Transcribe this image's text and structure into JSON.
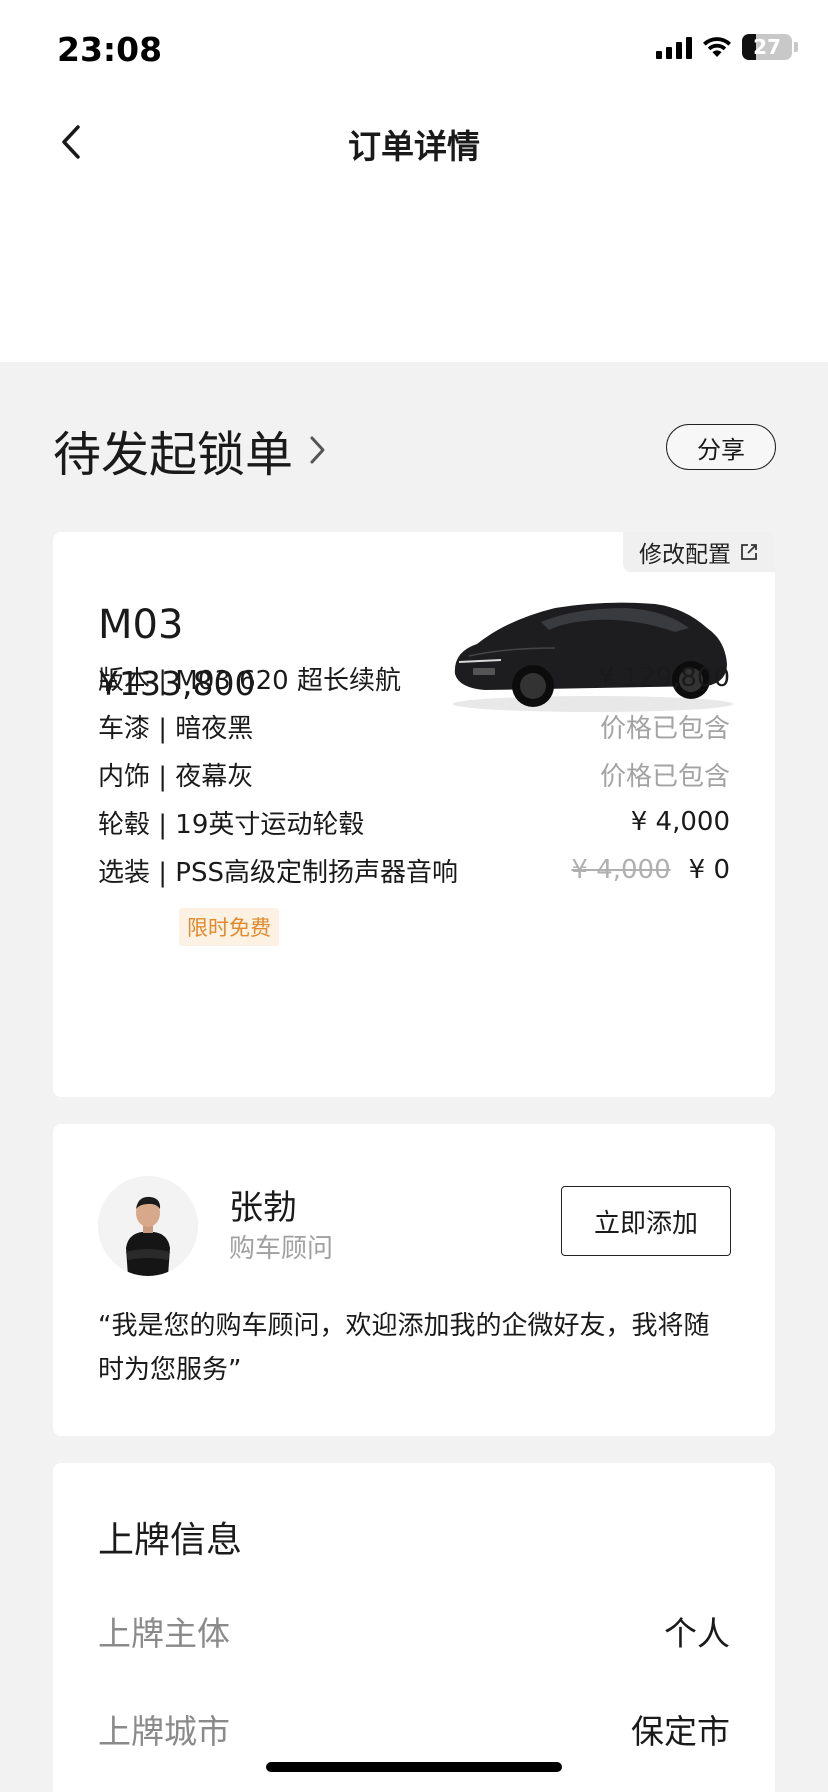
{
  "status_bar": {
    "time": "23:08",
    "battery": "27",
    "battery_level": 0.27
  },
  "nav": {
    "title": "订单详情"
  },
  "order": {
    "status": "待发起锁单",
    "share_label": "分享"
  },
  "config_card": {
    "modify_label": "修改配置",
    "model": "M03",
    "total_price": "¥133,800",
    "specs": [
      {
        "label": "版本 | M03 620 超长续航",
        "value": "¥ 129,800",
        "muted": false
      },
      {
        "label": "车漆 | 暗夜黑",
        "value": "价格已包含",
        "muted": true
      },
      {
        "label": "内饰 | 夜幕灰",
        "value": "价格已包含",
        "muted": true
      },
      {
        "label": "轮毂 | 19英寸运动轮毂",
        "value": "¥ 4,000",
        "muted": false
      },
      {
        "label": "选装 | PSS高级定制扬声器音响",
        "original_value": "¥ 4,000",
        "value": "¥ 0",
        "muted": false
      }
    ],
    "promo_tag": "限时免费"
  },
  "advisor": {
    "name": "张勃",
    "role": "购车顾问",
    "add_label": "立即添加",
    "quote": "“我是您的购车顾问，欢迎添加我的企微好友，我将随时为您服务”"
  },
  "plate_info": {
    "title": "上牌信息",
    "rows": [
      {
        "label": "上牌主体",
        "value": "个人"
      },
      {
        "label": "上牌城市",
        "value": "保定市"
      }
    ]
  },
  "icons": {
    "back": "chevron-left-icon",
    "status_arrow": "chevron-right-icon",
    "modify": "external-link-icon",
    "signal": "signal-icon",
    "wifi": "wifi-icon",
    "battery": "battery-icon"
  }
}
